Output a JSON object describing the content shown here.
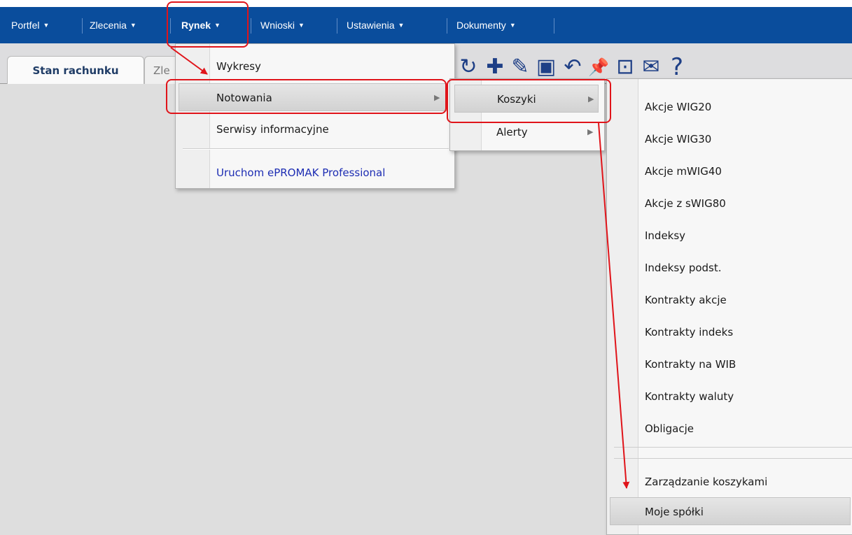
{
  "nav": {
    "items": [
      {
        "label": "Portfel"
      },
      {
        "label": "Zlecenia"
      },
      {
        "label": "Rynek"
      },
      {
        "label": "Wnioski"
      },
      {
        "label": "Ustawienia"
      },
      {
        "label": "Dokumenty"
      }
    ],
    "caret": "▼"
  },
  "tabs": {
    "active": "Stan rachunku",
    "partial": "Zle"
  },
  "toolbar": {
    "refresh": "↻",
    "add": "✚",
    "edit": "✎",
    "save": "▣",
    "undo": "↶",
    "pin": "📌",
    "fit": "⊡",
    "mail": "✉",
    "help": "?"
  },
  "menu_rynek": {
    "items": [
      "Wykresy",
      "Notowania",
      "Serwisy informacyjne",
      "Uruchom ePROMAK Professional"
    ]
  },
  "menu_notowania": {
    "items": [
      "Koszyki",
      "Alerty"
    ]
  },
  "menu_koszyki": {
    "items": [
      "Akcje WIG20",
      "Akcje WIG30",
      "Akcje mWIG40",
      "Akcje z sWIG80",
      "Indeksy",
      "Indeksy podst.",
      "Kontrakty akcje",
      "Kontrakty indeks",
      "Kontrakty na WIB",
      "Kontrakty waluty",
      "Obligacje"
    ],
    "footer": [
      "Zarządzanie koszykami",
      "Moje spółki"
    ]
  },
  "colors": {
    "nav_bg": "#0a4d9c",
    "annotation": "#e0141a",
    "link": "#1d2db3"
  }
}
